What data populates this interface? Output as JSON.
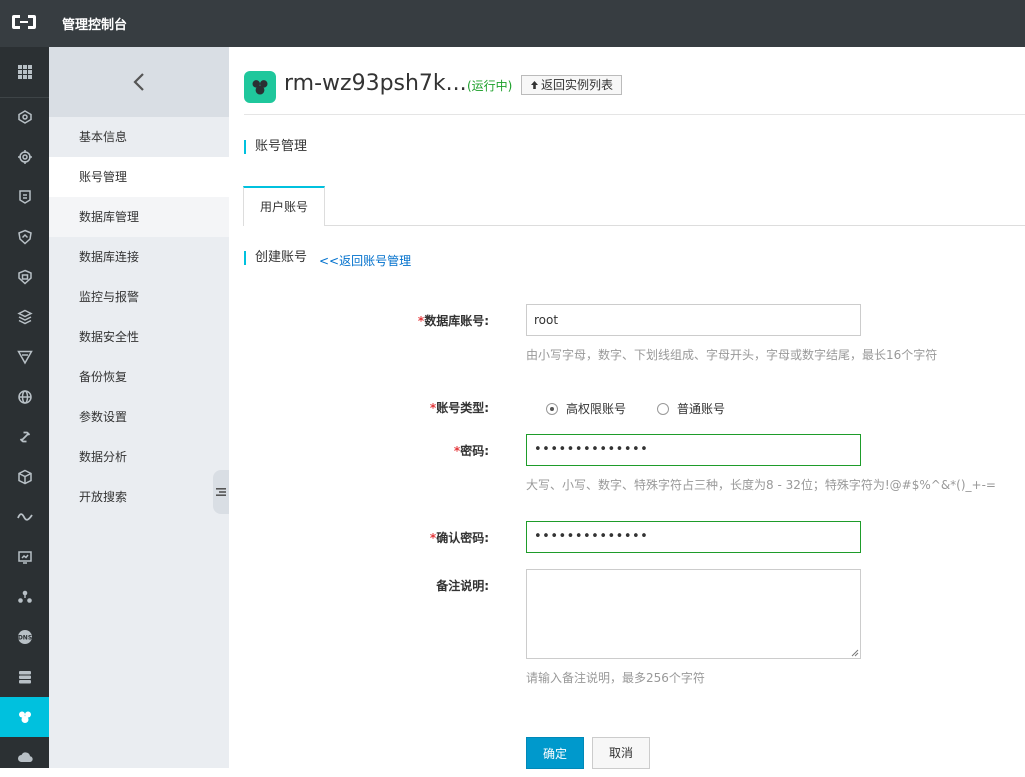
{
  "header": {
    "title": "管理控制台"
  },
  "subnav": {
    "items": [
      {
        "label": "基本信息"
      },
      {
        "label": "账号管理"
      },
      {
        "label": "数据库管理"
      },
      {
        "label": "数据库连接"
      },
      {
        "label": "监控与报警"
      },
      {
        "label": "数据安全性"
      },
      {
        "label": "备份恢复"
      },
      {
        "label": "参数设置"
      },
      {
        "label": "数据分析"
      },
      {
        "label": "开放搜索"
      }
    ]
  },
  "instance": {
    "name": "rm-wz93psh7k...",
    "status": "(运行中)",
    "back_button": "返回实例列表"
  },
  "section": {
    "title": "账号管理"
  },
  "tabs": [
    {
      "label": "用户账号"
    }
  ],
  "form": {
    "title": "创建账号",
    "back_link": "<<返回账号管理",
    "account": {
      "label": "数据库账号:",
      "value": "root",
      "hint": "由小写字母，数字、下划线组成、字母开头，字母或数字结尾，最长16个字符"
    },
    "account_type": {
      "label": "账号类型:",
      "options": [
        "高权限账号",
        "普通账号"
      ],
      "selected": "高权限账号"
    },
    "password": {
      "label": "密码:",
      "value": "••••••••••••••",
      "hint": "大写、小写、数字、特殊字符占三种，长度为8 - 32位；特殊字符为!@#$%^&*()_+-="
    },
    "confirm_password": {
      "label": "确认密码:",
      "value": "••••••••••••••"
    },
    "remark": {
      "label": "备注说明:",
      "hint": "请输入备注说明，最多256个字符"
    },
    "submit_label": "确定",
    "cancel_label": "取消"
  },
  "colors": {
    "topbar": "#373d41",
    "iconbar": "#2b3033",
    "accent": "#00c1de",
    "primary_button": "#0099cc",
    "valid_border": "#1e9c2a",
    "status_green": "#1da02b",
    "required": "#e4393c"
  }
}
